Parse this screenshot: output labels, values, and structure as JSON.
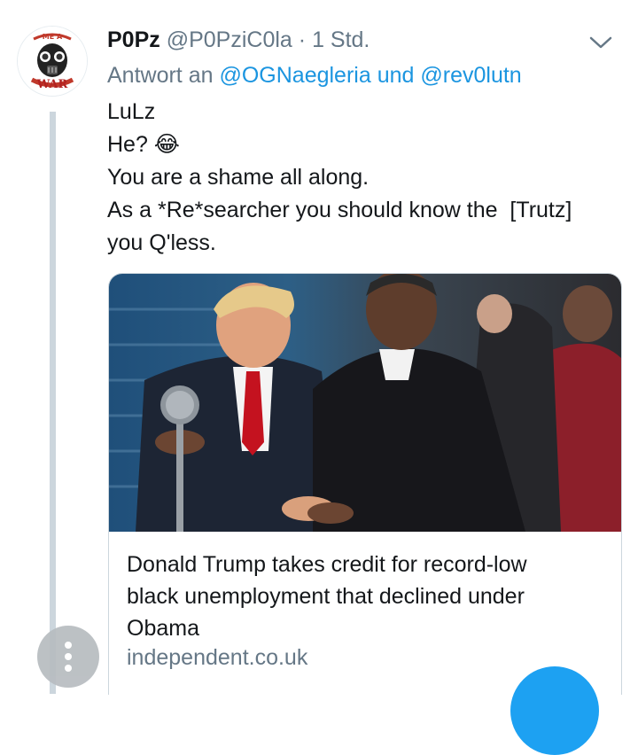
{
  "tweet": {
    "display_name": "P0Pz",
    "handle": "@P0PziC0la",
    "separator": "·",
    "time": "1 Std.",
    "reply_prefix": "Antwort an",
    "reply_user1": "@OGNaegleria",
    "reply_conj": "und",
    "reply_user2": "@rev0lutn",
    "lines": [
      "LuLz",
      "He? 😂",
      "You are a shame all along.",
      "As a *Re*searcher you should know the  [Trutz]",
      "you Q'less."
    ],
    "avatar_text_top": "ME A",
    "avatar_text_bottom": "WAR",
    "icons": {
      "menu": "chevron-down-icon",
      "more": "more-vertical-icon",
      "compose": "compose-fab-icon"
    }
  },
  "card": {
    "title_line1": "Donald Trump takes credit for record-low",
    "title_line2": "black unemployment that declined under",
    "title_line3": "Obama",
    "domain": "independent.co.uk"
  },
  "colors": {
    "accent": "#1da1f2",
    "link": "#1b95e0",
    "muted": "#657786"
  }
}
